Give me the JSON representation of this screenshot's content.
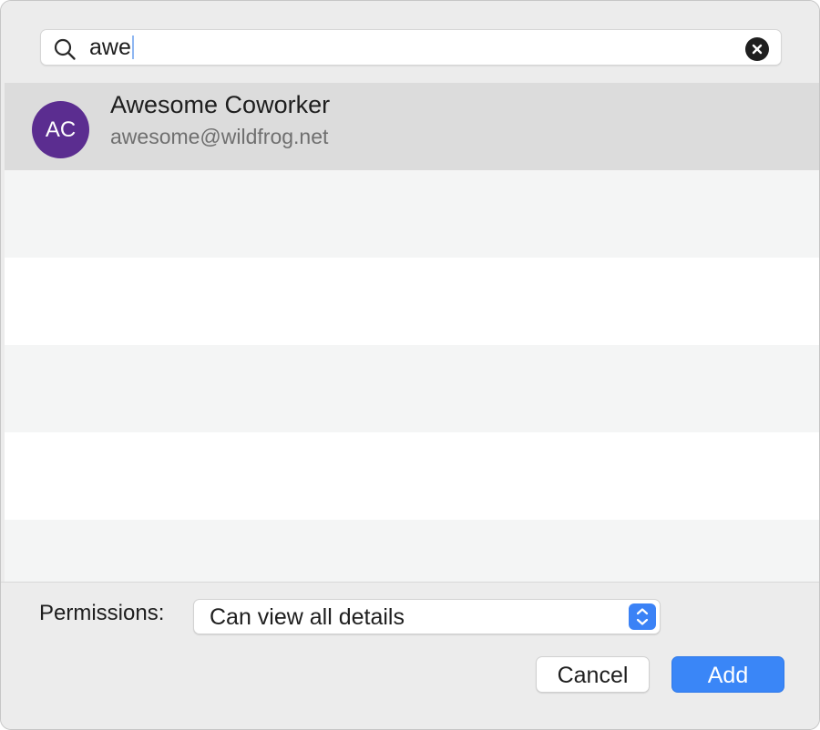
{
  "search": {
    "value": "awe",
    "icon": "search-icon",
    "clear_icon": "clear-icon"
  },
  "results": [
    {
      "initials": "AC",
      "name": "Awesome Coworker",
      "email": "awesome@wildfrog.net",
      "avatar_color": "#5b2d90",
      "selected": true
    }
  ],
  "permissions": {
    "label": "Permissions:",
    "selected_value": "Can view all details"
  },
  "buttons": {
    "cancel_label": "Cancel",
    "add_label": "Add"
  },
  "colors": {
    "accent": "#3a86f7",
    "selection": "#dcdcdc",
    "stripe": "#f4f5f5"
  }
}
